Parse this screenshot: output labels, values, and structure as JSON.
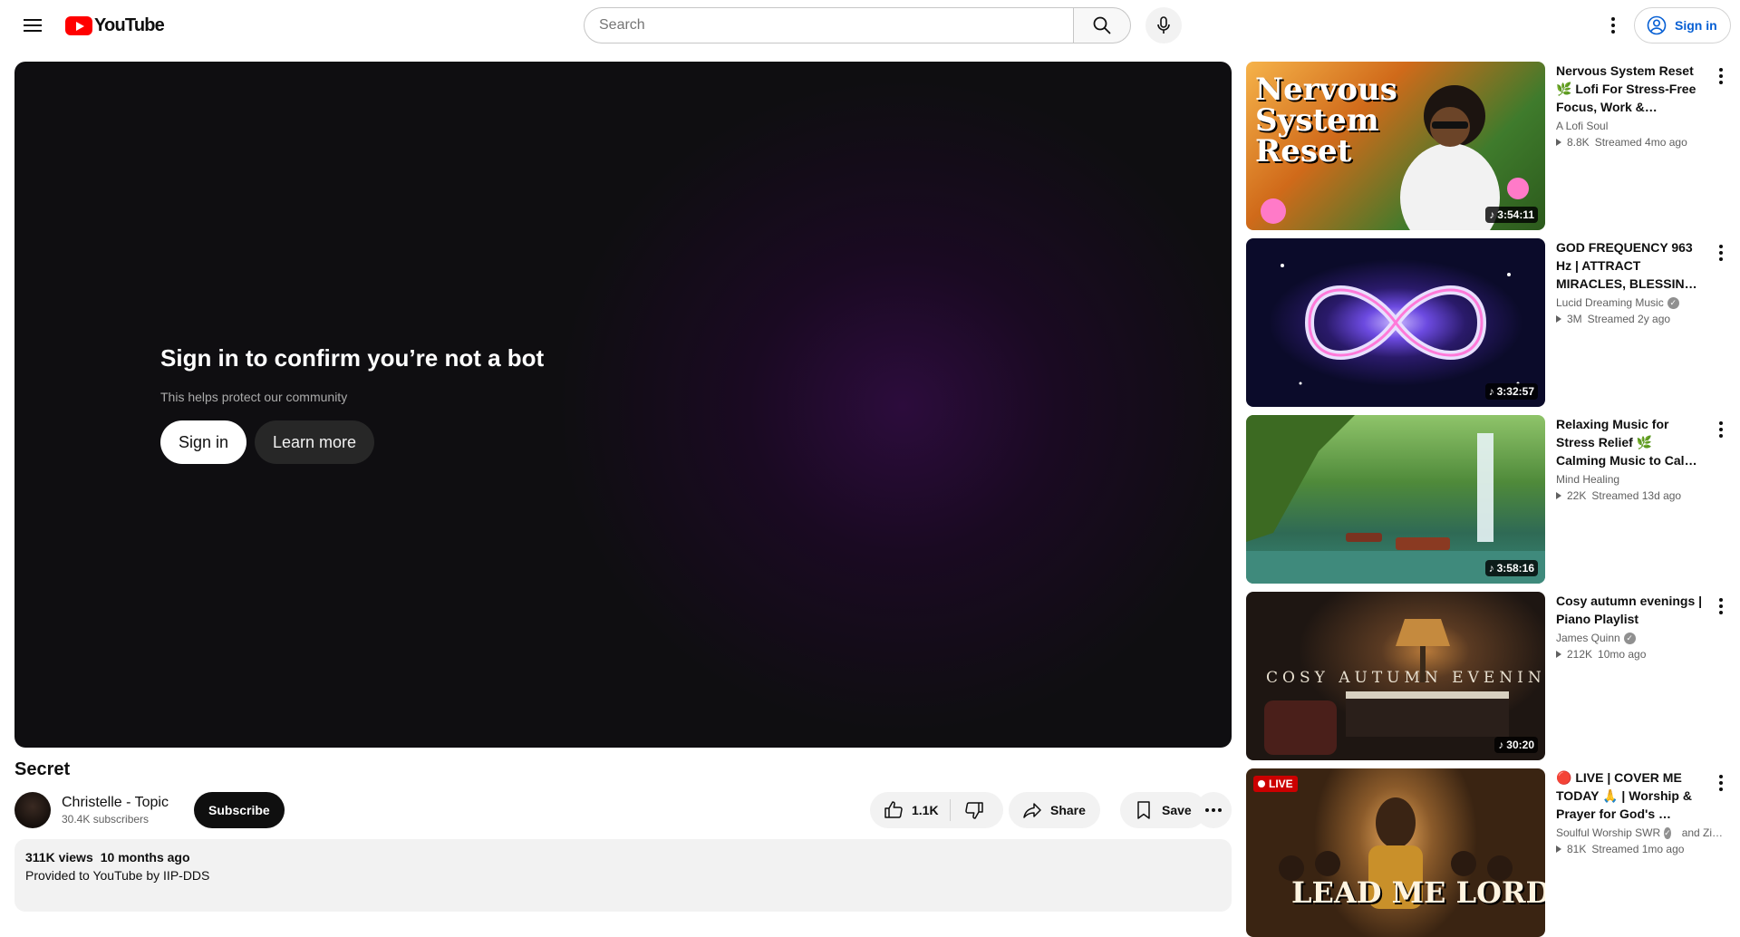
{
  "header": {
    "logo_text": "YouTube",
    "search_placeholder": "Search",
    "signin_label": "Sign in"
  },
  "player": {
    "bot_title": "Sign in to confirm you’re not a bot",
    "bot_subtitle": "This helps protect our community",
    "signin_label": "Sign in",
    "learn_more_label": "Learn more"
  },
  "video": {
    "title": "Secret",
    "channel": "Christelle - Topic",
    "subscribers": "30.4K subscribers",
    "subscribe_label": "Subscribe",
    "likes": "1.1K",
    "share_label": "Share",
    "save_label": "Save",
    "views": "311K views",
    "age": "10 months ago",
    "provided_by": "Provided to YouTube by IIP-DDS"
  },
  "recommendations": [
    {
      "title": "Nervous System Reset 🌿 Lofi For Stress-Free Focus, Work & Journaling",
      "channel": "A Lofi Soul",
      "verified": false,
      "extra_channel": "",
      "views": "8.8K",
      "age": "Streamed 4mo ago",
      "duration": "3:54:11",
      "live": false,
      "thumb_text": "Nervous System Reset"
    },
    {
      "title": "GOD FREQUENCY 963 Hz | ATTRACT MIRACLES, BLESSINGS AND GREAT…",
      "channel": "Lucid Dreaming Music",
      "verified": true,
      "extra_channel": "",
      "views": "3M",
      "age": "Streamed 2y ago",
      "duration": "3:32:57",
      "live": false,
      "thumb_text": ""
    },
    {
      "title": "Relaxing Music for Stress Relief 🌿 Calming Music to Calm the Mind, Heal …",
      "channel": "Mind Healing",
      "verified": false,
      "extra_channel": "",
      "views": "22K",
      "age": "Streamed 13d ago",
      "duration": "3:58:16",
      "live": false,
      "thumb_text": ""
    },
    {
      "title": "Cosy autumn evenings | Piano Playlist",
      "channel": "James Quinn",
      "verified": true,
      "extra_channel": "",
      "views": "212K",
      "age": "10mo ago",
      "duration": "30:20",
      "live": false,
      "thumb_text": "COSY AUTUMN EVENINGS"
    },
    {
      "title": "🔴 LIVE | COVER ME TODAY 🙏 | Worship & Prayer for God's …",
      "channel": "Soulful Worship SWR",
      "verified": true,
      "extra_channel": "and Zi…",
      "views": "81K",
      "age": "Streamed 1mo ago",
      "duration": "",
      "live": true,
      "live_label": "LIVE",
      "thumb_text": "LEAD ME LORD"
    }
  ],
  "colors": {
    "brand_red": "#ff0000",
    "link_blue": "#065fd4",
    "live_red": "#cc0000"
  }
}
